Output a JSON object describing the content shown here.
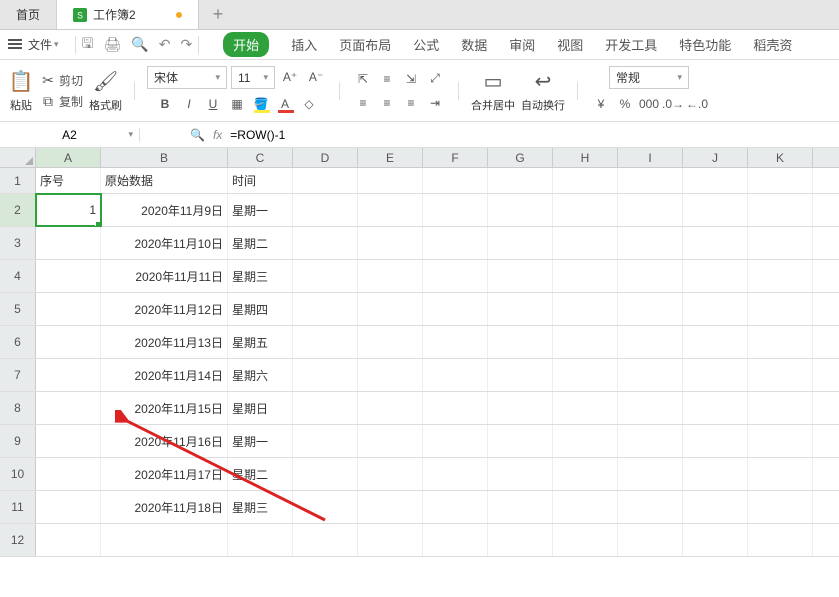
{
  "tabs": {
    "home": "首页",
    "doc": "工作簿2"
  },
  "menu": {
    "file": "文件",
    "ribbon": [
      "开始",
      "插入",
      "页面布局",
      "公式",
      "数据",
      "审阅",
      "视图",
      "开发工具",
      "特色功能",
      "稻壳资"
    ]
  },
  "ribbon": {
    "paste": "粘贴",
    "copy": "复制",
    "cut": "剪切",
    "brush": "格式刷",
    "font_name": "宋体",
    "font_size": "11",
    "merge": "合并居中",
    "wrap": "自动换行",
    "numfmt": "常规"
  },
  "formula": {
    "cellref": "A2",
    "value": "=ROW()-1"
  },
  "columns": [
    "A",
    "B",
    "C",
    "D",
    "E",
    "F",
    "G",
    "H",
    "I",
    "J",
    "K"
  ],
  "headers": {
    "A": "序号",
    "B": "原始数据",
    "C": "时间"
  },
  "data": [
    {
      "a": "1",
      "b": "2020年11月9日",
      "c": "星期一"
    },
    {
      "a": "",
      "b": "2020年11月10日",
      "c": "星期二"
    },
    {
      "a": "",
      "b": "2020年11月11日",
      "c": "星期三"
    },
    {
      "a": "",
      "b": "2020年11月12日",
      "c": "星期四"
    },
    {
      "a": "",
      "b": "2020年11月13日",
      "c": "星期五"
    },
    {
      "a": "",
      "b": "2020年11月14日",
      "c": "星期六"
    },
    {
      "a": "",
      "b": "2020年11月15日",
      "c": "星期日"
    },
    {
      "a": "",
      "b": "2020年11月16日",
      "c": "星期一"
    },
    {
      "a": "",
      "b": "2020年11月17日",
      "c": "星期二"
    },
    {
      "a": "",
      "b": "2020年11月18日",
      "c": "星期三"
    }
  ]
}
